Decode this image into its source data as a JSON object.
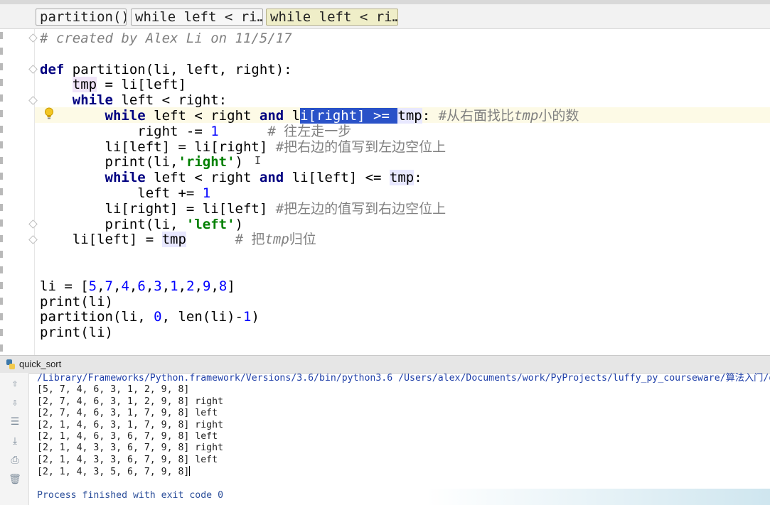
{
  "breadcrumbs": [
    "partition()",
    "while left < ri…",
    "while left < ri…"
  ],
  "editor": {
    "lines": [
      [
        {
          "t": "# created by Alex Li on 11/5/17",
          "c": "cm"
        }
      ],
      [],
      [
        {
          "t": "def",
          "c": "kw"
        },
        {
          "t": " partition(li, left, right):"
        }
      ],
      [
        {
          "t": "    "
        },
        {
          "t": "tmp",
          "c": "tmpdef"
        },
        {
          "t": " = li[left]"
        }
      ],
      [
        {
          "t": "    "
        },
        {
          "t": "while",
          "c": "kw"
        },
        {
          "t": " left < right:"
        }
      ],
      [
        {
          "t": "        "
        },
        {
          "t": "while",
          "c": "kw"
        },
        {
          "t": " left < right "
        },
        {
          "t": "and",
          "c": "kw"
        },
        {
          "t": " l"
        },
        {
          "t": "i[right] >= ",
          "c": "sel"
        },
        {
          "t": "tmp",
          "c": "var"
        },
        {
          "t": ": "
        },
        {
          "t": "#从右面找比",
          "c": "cm-cn"
        },
        {
          "t": "tmp",
          "c": "cm"
        },
        {
          "t": "小的数",
          "c": "cm-cn"
        }
      ],
      [
        {
          "t": "            right -= "
        },
        {
          "t": "1",
          "c": "num"
        },
        {
          "t": "      "
        },
        {
          "t": "# 往左走一步",
          "c": "cm-cn"
        }
      ],
      [
        {
          "t": "        li[left] = li[right] "
        },
        {
          "t": "#把右边的值写到左边空位上",
          "c": "cm-cn"
        }
      ],
      [
        {
          "t": "        print(li,"
        },
        {
          "t": "'right'",
          "c": "str"
        },
        {
          "t": ")"
        }
      ],
      [
        {
          "t": "        "
        },
        {
          "t": "while",
          "c": "kw"
        },
        {
          "t": " left < right "
        },
        {
          "t": "and",
          "c": "kw"
        },
        {
          "t": " li[left] <= "
        },
        {
          "t": "tmp",
          "c": "var"
        },
        {
          "t": ":"
        }
      ],
      [
        {
          "t": "            left += "
        },
        {
          "t": "1",
          "c": "num"
        }
      ],
      [
        {
          "t": "        li[right] = li[left] "
        },
        {
          "t": "#把左边的值写到右边空位上",
          "c": "cm-cn"
        }
      ],
      [
        {
          "t": "        print(li, "
        },
        {
          "t": "'left'",
          "c": "str"
        },
        {
          "t": ")"
        }
      ],
      [
        {
          "t": "    li[left] = "
        },
        {
          "t": "tmp",
          "c": "var"
        },
        {
          "t": "      "
        },
        {
          "t": "# 把",
          "c": "cm-cn"
        },
        {
          "t": "tmp",
          "c": "cm"
        },
        {
          "t": "归位",
          "c": "cm-cn"
        }
      ],
      [],
      [],
      [
        {
          "t": "li = ["
        },
        {
          "t": "5",
          "c": "num"
        },
        {
          "t": ","
        },
        {
          "t": "7",
          "c": "num"
        },
        {
          "t": ","
        },
        {
          "t": "4",
          "c": "num"
        },
        {
          "t": ","
        },
        {
          "t": "6",
          "c": "num"
        },
        {
          "t": ","
        },
        {
          "t": "3",
          "c": "num"
        },
        {
          "t": ","
        },
        {
          "t": "1",
          "c": "num"
        },
        {
          "t": ","
        },
        {
          "t": "2",
          "c": "num"
        },
        {
          "t": ","
        },
        {
          "t": "9",
          "c": "num"
        },
        {
          "t": ","
        },
        {
          "t": "8",
          "c": "num"
        },
        {
          "t": "]"
        }
      ],
      [
        {
          "t": "print(li)"
        }
      ],
      [
        {
          "t": "partition(li, "
        },
        {
          "t": "0",
          "c": "num"
        },
        {
          "t": ", len(li)-"
        },
        {
          "t": "1",
          "c": "num"
        },
        {
          "t": ")"
        }
      ],
      [
        {
          "t": "print(li)"
        }
      ]
    ]
  },
  "run": {
    "tab_label": "quick_sort",
    "command": "/Library/Frameworks/Python.framework/Versions/3.6/bin/python3.6 /Users/alex/Documents/work/PyProjects/luffy_py_courseware/算法入门/quick_",
    "output": [
      "[5, 7, 4, 6, 3, 1, 2, 9, 8]",
      "[2, 7, 4, 6, 3, 1, 2, 9, 8] right",
      "[2, 7, 4, 6, 3, 1, 7, 9, 8] left",
      "[2, 1, 4, 6, 3, 1, 7, 9, 8] right",
      "[2, 1, 4, 6, 3, 6, 7, 9, 8] left",
      "[2, 1, 4, 3, 3, 6, 7, 9, 8] right",
      "[2, 1, 4, 3, 3, 6, 7, 9, 8] left",
      "[2, 1, 4, 3, 5, 6, 7, 9, 8]"
    ],
    "exit_message": "Process finished with exit code 0"
  },
  "icons": {
    "bulb": "lightbulb-icon",
    "python": "python-icon",
    "tools": [
      "arrow-up-icon",
      "arrow-down-icon",
      "soft-wrap-icon",
      "scroll-to-end-icon",
      "print-icon",
      "trash-icon"
    ]
  }
}
